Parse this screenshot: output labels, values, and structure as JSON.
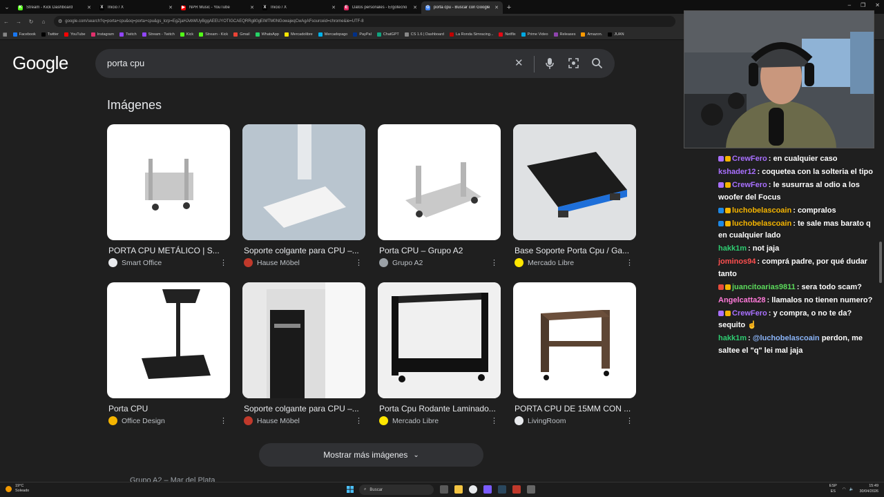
{
  "browser": {
    "tabs": [
      {
        "label": "Stream - Kick Dashboard",
        "icon_color": "#53fc18",
        "icon": "K"
      },
      {
        "label": "Inicio / X",
        "icon_color": "#000000",
        "icon": "X"
      },
      {
        "label": "NPR Music - YouTube",
        "icon_color": "#ff0000",
        "icon": "▶"
      },
      {
        "label": "Inicio / X",
        "icon_color": "#000000",
        "icon": "X"
      },
      {
        "label": "Datos personales - Ergotecno",
        "icon_color": "#e0245e",
        "icon": "E"
      },
      {
        "label": "porta cpu - Buscar con Google",
        "icon_color": "#4285f4",
        "icon": "G",
        "active": true
      }
    ],
    "url": "google.com/search?q=porta+cpu&oq=porta+cpu&gs_lcrp=EgZjaHJvbWUyBggAEEUYOTIGCAEQRRg80gEIMTM0NGowajeqCwAgAFsourceid=chrome&ie=UTF-8",
    "bookmarks": [
      {
        "label": "Facebook",
        "color": "#1877f2"
      },
      {
        "label": "Twitter",
        "color": "#000000"
      },
      {
        "label": "YouTube",
        "color": "#ff0000"
      },
      {
        "label": "Instagram",
        "color": "#e1306c"
      },
      {
        "label": "Twitch",
        "color": "#9146ff"
      },
      {
        "label": "Stream - Twitch",
        "color": "#9146ff"
      },
      {
        "label": "Kick",
        "color": "#53fc18"
      },
      {
        "label": "Stream - Kick",
        "color": "#53fc18"
      },
      {
        "label": "Gmail",
        "color": "#ea4335"
      },
      {
        "label": "WhatsApp",
        "color": "#25d366"
      },
      {
        "label": "Mercadolibre",
        "color": "#ffe600"
      },
      {
        "label": "Mercadopago",
        "color": "#00b1ea"
      },
      {
        "label": "PayPal",
        "color": "#003087"
      },
      {
        "label": "ChatGPT",
        "color": "#10a37f"
      },
      {
        "label": "CS 1.6 | Dashboard",
        "color": "#888888"
      },
      {
        "label": "La Ronda Simracing...",
        "color": "#c00000"
      },
      {
        "label": "Netflix",
        "color": "#e50914"
      },
      {
        "label": "Prime Video",
        "color": "#00a8e1"
      },
      {
        "label": "Releases",
        "color": "#8e44ad"
      },
      {
        "label": "Amazon.",
        "color": "#ff9900"
      },
      {
        "label": "JUAN",
        "color": "#000000"
      }
    ]
  },
  "google": {
    "logo": "Google",
    "query": "porta cpu",
    "section_title": "Imágenes",
    "more_button": "Mostrar más imágenes",
    "next_result": "Grupo A2 – Mar del Plata",
    "images": [
      {
        "title": "PORTA CPU METÁLICO | S...",
        "source": "Smart Office",
        "src_color": "#e8eaed"
      },
      {
        "title": "Soporte colgante para CPU –...",
        "source": "Hause Möbel",
        "src_color": "#c0392b"
      },
      {
        "title": "Porta CPU – Grupo A2",
        "source": "Grupo A2",
        "src_color": "#9aa0a6"
      },
      {
        "title": "Base Soporte Porta Cpu / Ga...",
        "source": "Mercado Libre",
        "src_color": "#ffe600"
      },
      {
        "title": "Porta CPU",
        "source": "Office Design",
        "src_color": "#f4b400"
      },
      {
        "title": "Soporte colgante para CPU –...",
        "source": "Hause Möbel",
        "src_color": "#c0392b"
      },
      {
        "title": "Porta Cpu Rodante Laminado...",
        "source": "Mercado Libre",
        "src_color": "#ffe600"
      },
      {
        "title": "PORTA CPU DE 15MM CON ...",
        "source": "LivingRoom",
        "src_color": "#e8eaed"
      }
    ]
  },
  "chat": [
    {
      "user": "CrewFero",
      "user_color": "#a970ff",
      "text": "en cualquier caso",
      "badges": [
        "#a970ff",
        "#f4b400"
      ]
    },
    {
      "user": "kshader12",
      "user_color": "#a970ff",
      "text": "coquetea con la solteria el tipo",
      "badges": []
    },
    {
      "user": "CrewFero",
      "user_color": "#a970ff",
      "text": "le susurras al odio a los woofer del Focus",
      "badges": [
        "#a970ff",
        "#f4b400"
      ]
    },
    {
      "user": "luchobelascoain",
      "user_color": "#f4b400",
      "text": "compralos",
      "badges": [
        "#1e88e5",
        "#f4b400"
      ]
    },
    {
      "user": "luchobelascoain",
      "user_color": "#f4b400",
      "text": "te sale mas barato q en cualquier lado",
      "badges": [
        "#1e88e5",
        "#f4b400"
      ]
    },
    {
      "user": "hakk1m",
      "user_color": "#2ecc71",
      "text": "not jaja",
      "badges": []
    },
    {
      "user": "jominos94",
      "user_color": "#ff4f4f",
      "text": "comprá padre, por qué dudar tanto",
      "badges": []
    },
    {
      "user": "juancitoarias9811",
      "user_color": "#5cdb5c",
      "text": "sera todo scam?",
      "badges": [
        "#e74c3c",
        "#f4b400"
      ]
    },
    {
      "user": "Angelcatta28",
      "user_color": "#ff7ad9",
      "text": "llamalos no tienen numero?",
      "badges": []
    },
    {
      "user": "CrewFero",
      "user_color": "#a970ff",
      "text": "y compra, o no te da? sequito ☝",
      "badges": [
        "#a970ff",
        "#f4b400"
      ]
    },
    {
      "user": "hakk1m",
      "user_color": "#2ecc71",
      "mention": "@luchobelascoain",
      "text": "perdon, me saltee el \"q\" lei mal jaja",
      "badges": []
    }
  ],
  "taskbar": {
    "weather_temp": "19°C",
    "weather_desc": "Soleado",
    "search_placeholder": "Buscar",
    "lang": "ESP",
    "lang2": "ES",
    "time": "15:49",
    "date": "30/04/2026"
  }
}
